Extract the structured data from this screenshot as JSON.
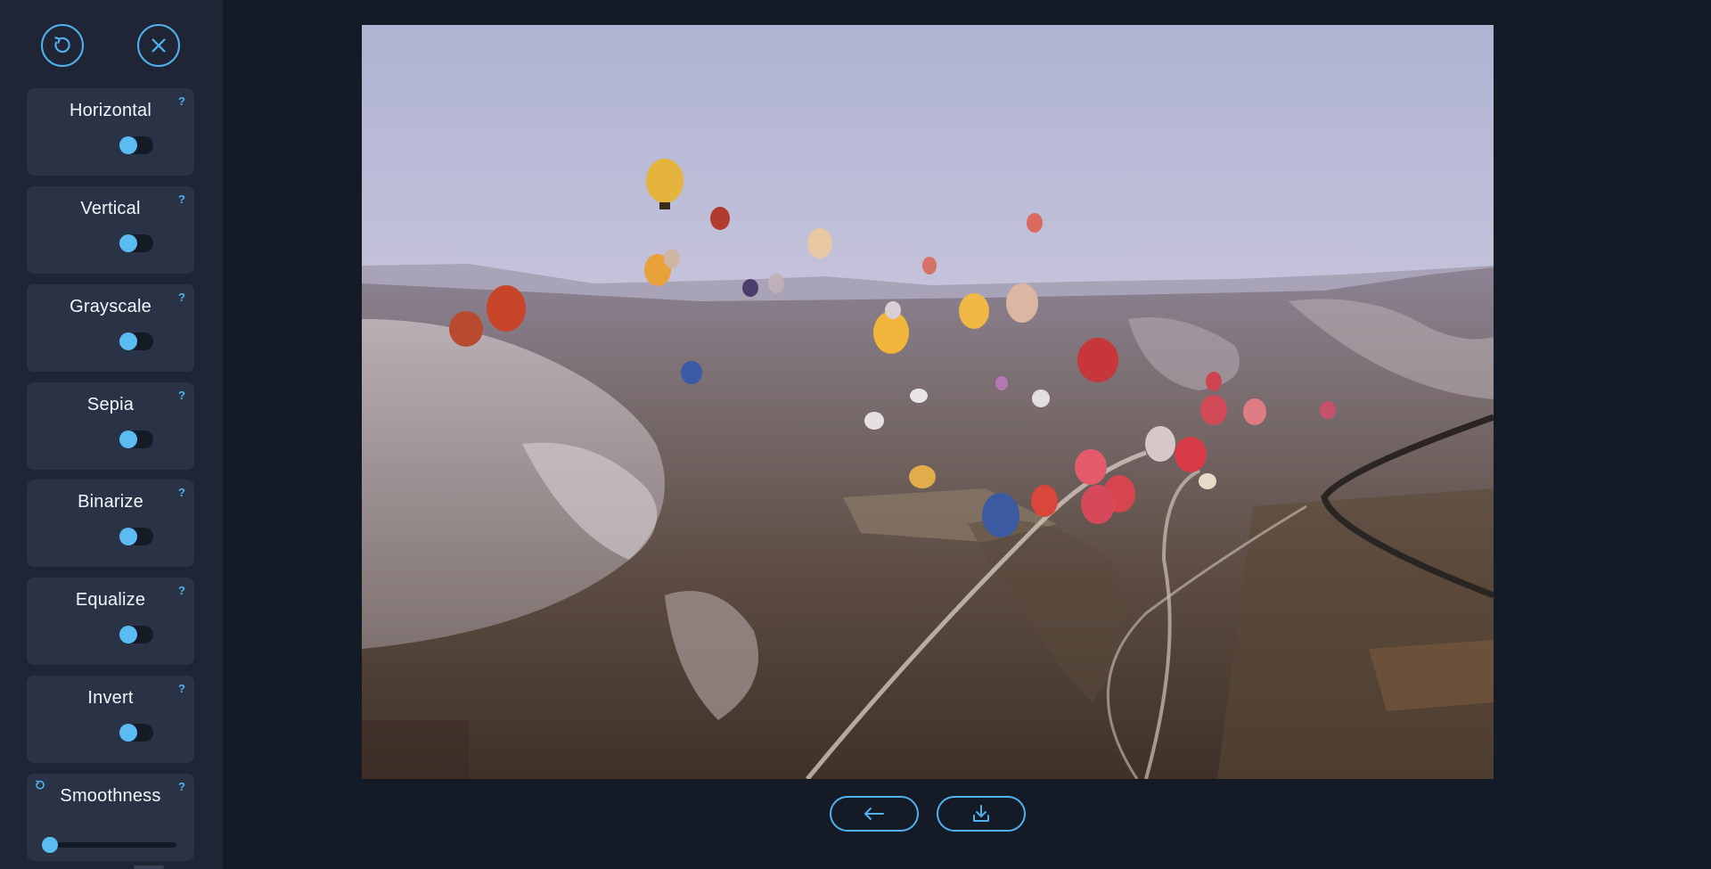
{
  "toolbar": {
    "reset_icon": "rotate-ccw-icon",
    "close_icon": "close-icon"
  },
  "filters": [
    {
      "label": "Horizontal",
      "help": "?",
      "enabled": false
    },
    {
      "label": "Vertical",
      "help": "?",
      "enabled": false
    },
    {
      "label": "Grayscale",
      "help": "?",
      "enabled": false
    },
    {
      "label": "Sepia",
      "help": "?",
      "enabled": false
    },
    {
      "label": "Binarize",
      "help": "?",
      "enabled": false
    },
    {
      "label": "Equalize",
      "help": "?",
      "enabled": false
    },
    {
      "label": "Invert",
      "help": "?",
      "enabled": false
    }
  ],
  "smoothness": {
    "label": "Smoothness",
    "help": "?",
    "value": 0
  },
  "actions": {
    "back_icon": "arrow-left-icon",
    "download_icon": "download-icon"
  },
  "colors": {
    "accent": "#4fb2ee",
    "toggle_knob": "#5bbcf4",
    "sidebar_bg": "#1f2535",
    "card_bg": "#2a3246",
    "page_bg": "#151a27"
  }
}
